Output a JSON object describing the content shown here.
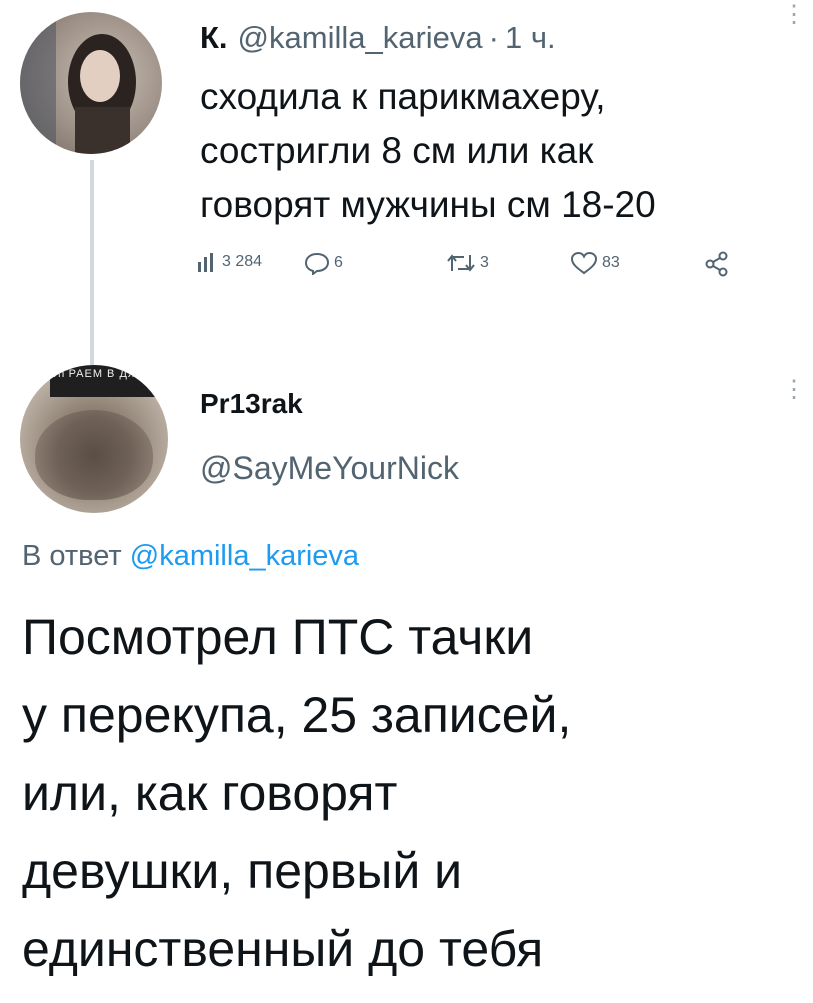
{
  "tweet1": {
    "display_name": "К.",
    "handle": "@kamilla_karieva",
    "separator": "·",
    "time": "1 ч.",
    "text": "сходила к парикмахеру,\nсостригли 8 см или как\nговорят мужчины см 18-20",
    "stats": {
      "views": "3 284",
      "replies": "6",
      "reposts": "3",
      "likes": "83"
    }
  },
  "tweet2": {
    "display_name": "Pr13rak",
    "handle": "@SayMeYourNick",
    "avatar_badge": "ИГРАЕМ В ДЖОЙ",
    "reply_prefix": "В ответ",
    "reply_handle": "@kamilla_karieva",
    "text": "Посмотрел ПТС тачки\nу перекупа, 25 записей,\nили, как говорят\nдевушки, первый и\nединственный до тебя"
  },
  "icons": {
    "views": "bar-chart-icon",
    "reply": "speech-bubble-icon",
    "repost": "repost-arrows-icon",
    "like": "heart-icon",
    "share": "share-icon",
    "more": "more-vertical-icon"
  },
  "colors": {
    "text": "#0f1419",
    "secondary": "#536471",
    "link": "#1d9bf0",
    "thread_line": "#cfd9de"
  }
}
